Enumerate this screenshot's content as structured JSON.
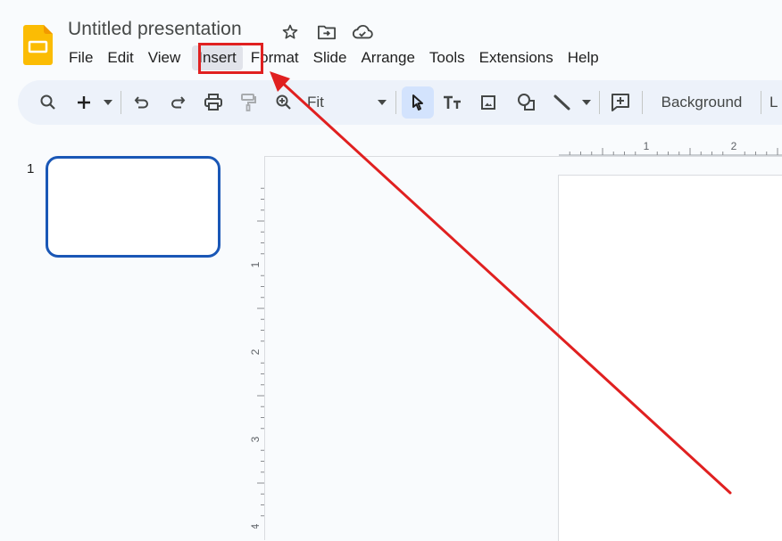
{
  "app": {
    "title": "Untitled presentation",
    "title_icons": [
      "star-icon",
      "move-to-folder-icon",
      "cloud-saved-icon"
    ],
    "brand_color": "#fbbc04"
  },
  "menubar": {
    "items": [
      {
        "label": "File"
      },
      {
        "label": "Edit"
      },
      {
        "label": "View"
      },
      {
        "label": "Insert",
        "active": true
      },
      {
        "label": "Format"
      },
      {
        "label": "Slide"
      },
      {
        "label": "Arrange"
      },
      {
        "label": "Tools"
      },
      {
        "label": "Extensions"
      },
      {
        "label": "Help"
      }
    ]
  },
  "toolbar": {
    "search_icon": "search-icon",
    "new_slide_icon": "plus-icon",
    "undo_icon": "undo-icon",
    "redo_icon": "redo-icon",
    "print_icon": "print-icon",
    "paint_format_icon": "paint-format-icon",
    "zoom_icon": "zoom-in-icon",
    "zoom_value": "Fit",
    "select_icon": "cursor-icon",
    "textbox_icon": "text-box-icon",
    "image_icon": "image-icon",
    "shape_icon": "shape-icon",
    "line_icon": "line-icon",
    "comment_icon": "add-comment-icon",
    "background_label": "Background",
    "layout_label_partial": "L"
  },
  "filmstrip": {
    "slides": [
      {
        "number": "1",
        "selected": true
      }
    ],
    "selection_color": "#1a57b6"
  },
  "rulers": {
    "horizontal_labels": [
      "1",
      "2"
    ],
    "vertical_labels": [
      "1",
      "2",
      "3",
      "4"
    ]
  },
  "annotation": {
    "highlight_target": "Insert",
    "color": "#e02020"
  }
}
